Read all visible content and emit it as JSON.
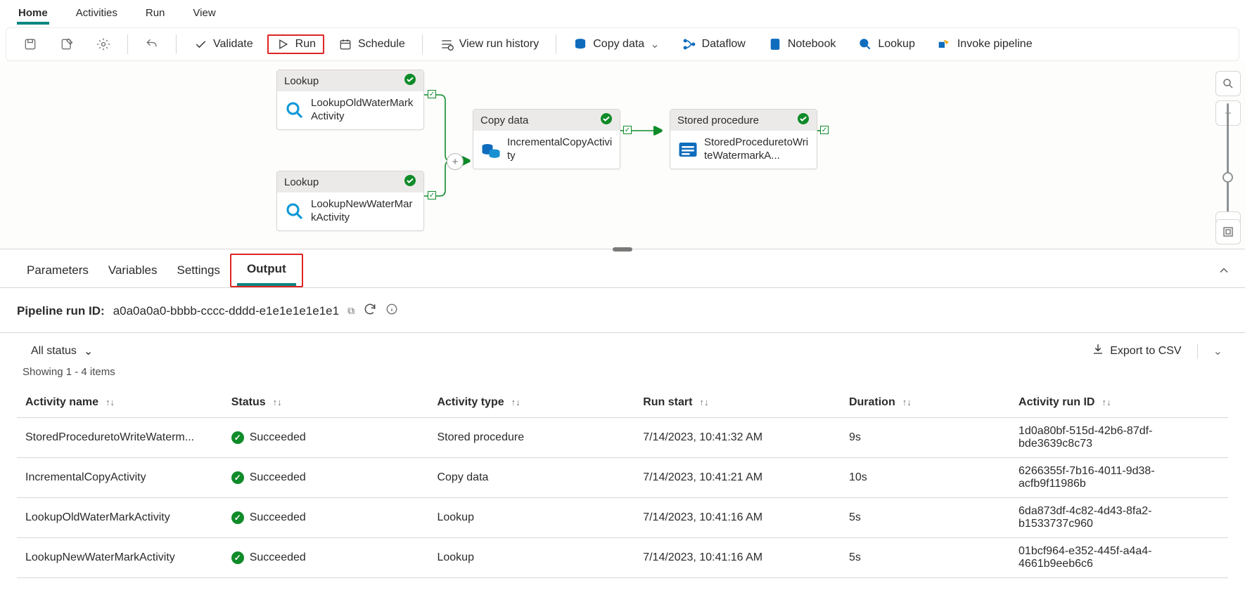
{
  "menu": {
    "items": [
      {
        "label": "Home",
        "active": true
      },
      {
        "label": "Activities"
      },
      {
        "label": "Run"
      },
      {
        "label": "View"
      }
    ]
  },
  "toolbar": {
    "validate": "Validate",
    "run": "Run",
    "schedule": "Schedule",
    "view_history": "View run history",
    "copy_data": "Copy data",
    "dataflow": "Dataflow",
    "notebook": "Notebook",
    "lookup": "Lookup",
    "invoke": "Invoke pipeline"
  },
  "canvas": {
    "nodes": [
      {
        "type": "Lookup",
        "name": "LookupOldWaterMarkActivity"
      },
      {
        "type": "Lookup",
        "name": "LookupNewWaterMarkActivity"
      },
      {
        "type": "Copy data",
        "name": "IncrementalCopyActivity"
      },
      {
        "type": "Stored procedure",
        "name": "StoredProceduretoWriteWatermarkA..."
      }
    ]
  },
  "prop_tabs": [
    {
      "label": "Parameters"
    },
    {
      "label": "Variables"
    },
    {
      "label": "Settings"
    },
    {
      "label": "Output",
      "active": true
    }
  ],
  "runid": {
    "label": "Pipeline run ID:",
    "value": "a0a0a0a0-bbbb-cccc-dddd-e1e1e1e1e1e1"
  },
  "filter": {
    "status": "All status",
    "export": "Export to CSV",
    "count": "Showing 1 - 4 items"
  },
  "table": {
    "headers": [
      "Activity name",
      "Status",
      "Activity type",
      "Run start",
      "Duration",
      "Activity run ID"
    ],
    "rows": [
      {
        "name": "StoredProceduretoWriteWaterm...",
        "status": "Succeeded",
        "type": "Stored procedure",
        "start": "7/14/2023, 10:41:32 AM",
        "dur": "9s",
        "id": "1d0a80bf-515d-42b6-87df-bde3639c8c73"
      },
      {
        "name": "IncrementalCopyActivity",
        "status": "Succeeded",
        "type": "Copy data",
        "start": "7/14/2023, 10:41:21 AM",
        "dur": "10s",
        "id": "6266355f-7b16-4011-9d38-acfb9f11986b"
      },
      {
        "name": "LookupOldWaterMarkActivity",
        "status": "Succeeded",
        "type": "Lookup",
        "start": "7/14/2023, 10:41:16 AM",
        "dur": "5s",
        "id": "6da873df-4c82-4d43-8fa2-b1533737c960"
      },
      {
        "name": "LookupNewWaterMarkActivity",
        "status": "Succeeded",
        "type": "Lookup",
        "start": "7/14/2023, 10:41:16 AM",
        "dur": "5s",
        "id": "01bcf964-e352-445f-a4a4-4661b9eeb6c6"
      }
    ]
  }
}
